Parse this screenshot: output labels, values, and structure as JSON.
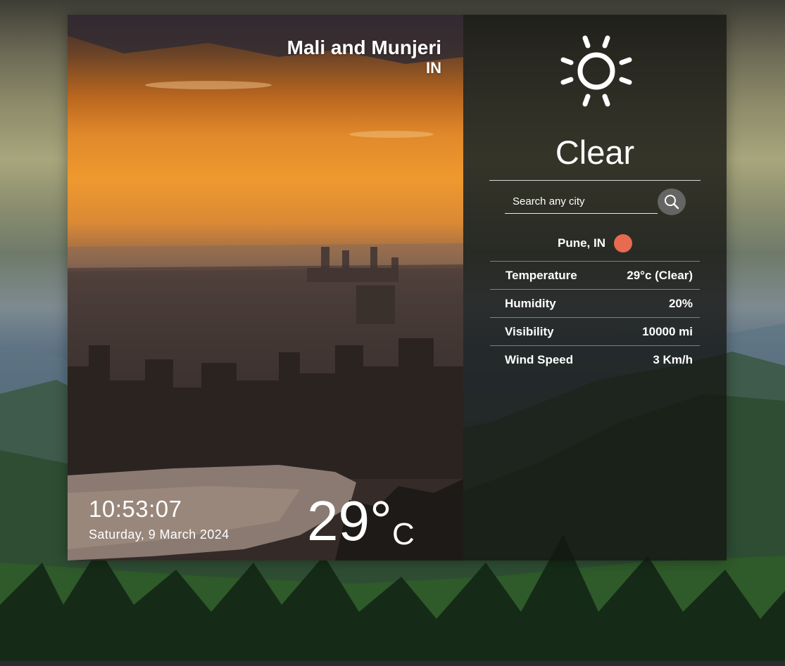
{
  "location": {
    "city": "Mali and Munjeri",
    "country": "IN"
  },
  "clock": {
    "time": "10:53:07",
    "date": "Saturday, 9 March 2024"
  },
  "temperature": {
    "value": "29°",
    "unit": "C"
  },
  "weather": {
    "condition": "Clear",
    "icon": "sun-icon",
    "search_placeholder": "Search any city",
    "current_city": "Pune, IN",
    "status_color": "#e86a4f",
    "stats": [
      {
        "label": "Temperature",
        "value": "29°c (Clear)"
      },
      {
        "label": "Humidity",
        "value": "20%"
      },
      {
        "label": "Visibility",
        "value": "10000 mi"
      },
      {
        "label": "Wind Speed",
        "value": "3 Km/h"
      }
    ]
  }
}
